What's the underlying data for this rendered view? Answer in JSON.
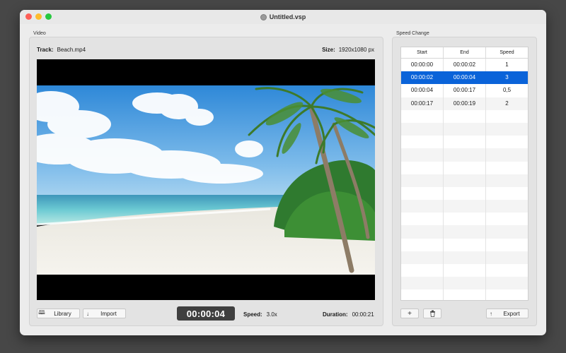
{
  "window": {
    "title": "Untitled.vsp"
  },
  "video_panel": {
    "section_label": "Video",
    "track_label": "Track:",
    "track_value": "Beach.mp4",
    "size_label": "Size:",
    "size_value": "1920x1080 px"
  },
  "controls": {
    "library_label": "Library",
    "import_label": "Import",
    "timecode": "00:00:04",
    "speed_label": "Speed:",
    "speed_value": "3.0x",
    "duration_label": "Duration:",
    "duration_value": "00:00:21"
  },
  "speed_panel": {
    "section_label": "Speed Change",
    "columns": [
      "Start",
      "End",
      "Speed"
    ],
    "rows": [
      [
        "00:00:00",
        "00:00:02",
        "1"
      ],
      [
        "00:00:02",
        "00:00:04",
        "3"
      ],
      [
        "00:00:04",
        "00:00:17",
        "0,5"
      ],
      [
        "00:00:17",
        "00:00:19",
        "2"
      ]
    ],
    "selected_row": 1,
    "add_icon": "plus-icon",
    "delete_icon": "trash-icon",
    "export_label": "Export"
  },
  "colors": {
    "selection": "#0a63d9",
    "timecode_bg": "#3f3f3f"
  }
}
